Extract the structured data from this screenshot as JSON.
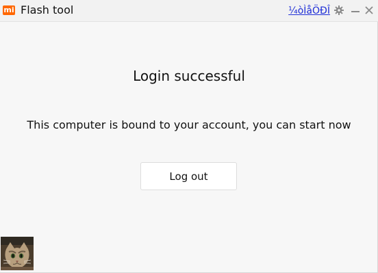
{
  "window": {
    "logo_text": "mi",
    "title": "Flash tool",
    "lang_link": "¼òÌåÖÐÎ",
    "icons": {
      "settings": "gear-icon",
      "minimize": "minimize-icon",
      "close": "close-icon"
    }
  },
  "main": {
    "heading": "Login successful",
    "message": "This computer is bound to your account, you can start now",
    "logout_label": "Log out"
  },
  "colors": {
    "brand": "#ff6700",
    "link": "#1f2fd7",
    "background": "#f7f7f7"
  }
}
